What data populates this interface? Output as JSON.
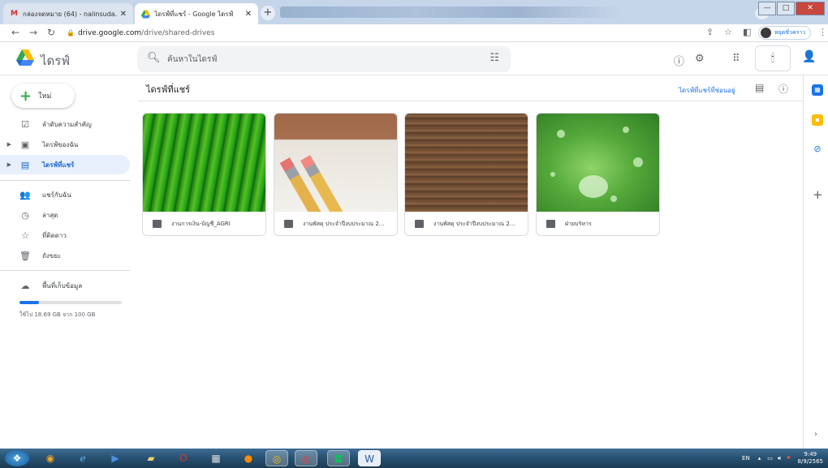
{
  "browser": {
    "tabs": [
      {
        "title": "กล่องจดหมาย (64) - nalinsuda.p",
        "icon": "gmail-icon",
        "active": false
      },
      {
        "title": "ไดรฟ์ที่แชร์ - Google ไดรฟ์",
        "icon": "google-drive-icon",
        "active": true
      }
    ],
    "url_domain": "drive.google.com",
    "url_path": "/drive/shared-drives",
    "profile_label": "หยุดชั่วคราว"
  },
  "header": {
    "app_name": "ไดรฟ์",
    "search_placeholder": "ค้นหาในไดรฟ์"
  },
  "sidebar": {
    "new_label": "ใหม่",
    "items": [
      {
        "label": "ลำดับความสำคัญ",
        "icon": "priority-check-icon",
        "selected": false,
        "expandable": false
      },
      {
        "label": "ไดรฟ์ของฉัน",
        "icon": "my-drive-icon",
        "selected": false,
        "expandable": true
      },
      {
        "label": "ไดรฟ์ที่แชร์",
        "icon": "shared-drives-icon",
        "selected": true,
        "expandable": true
      },
      {
        "label": "แชร์กับฉัน",
        "icon": "shared-with-me-icon",
        "selected": false,
        "expandable": false
      },
      {
        "label": "ล่าสุด",
        "icon": "clock-icon",
        "selected": false,
        "expandable": false
      },
      {
        "label": "ที่ติดดาว",
        "icon": "star-icon",
        "selected": false,
        "expandable": false
      },
      {
        "label": "ถังขยะ",
        "icon": "trash-icon",
        "selected": false,
        "expandable": false
      },
      {
        "label": "พื้นที่เก็บข้อมูล",
        "icon": "cloud-icon",
        "selected": false,
        "expandable": false
      }
    ],
    "storage_text": "ใช้ไป 18.69 GB จาก 100 GB",
    "storage_fraction": 0.187
  },
  "main": {
    "title": "ไดรฟ์ที่แชร์",
    "hidden_link": "ไดรฟ์ที่แชร์ที่ซ่อนอยู่",
    "drives": [
      {
        "name": "งานการเงิน-บัญชี_AGRI"
      },
      {
        "name": "งานพัสดุ ประจำปีงบประมาณ 2..."
      },
      {
        "name": "งานพัสดุ ประจำปีงบประมาณ 2..."
      },
      {
        "name": "ฝ่ายบริหาร"
      }
    ]
  },
  "taskbar": {
    "lang": "EN",
    "time": "9:49",
    "date": "8/9/2565"
  }
}
